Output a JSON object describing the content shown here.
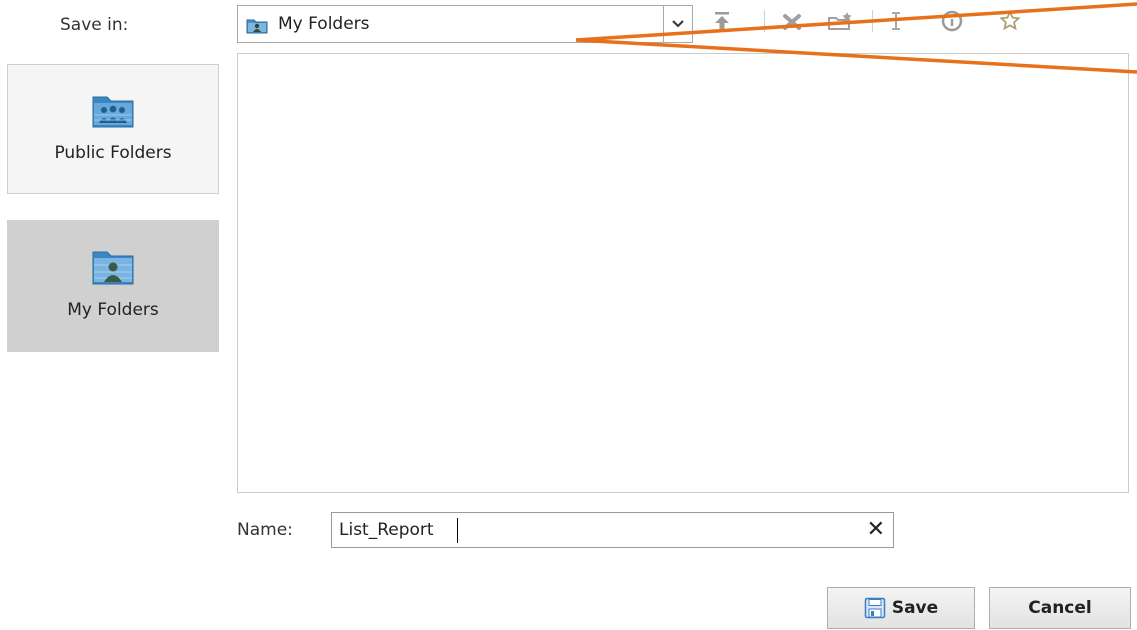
{
  "save_in": {
    "label": "Save in:",
    "current_folder": "My Folders"
  },
  "toolbar": {
    "icons": [
      "move-up-icon",
      "delete-icon",
      "new-folder-icon",
      "rename-icon",
      "properties-icon",
      "favorite-icon"
    ]
  },
  "places": [
    {
      "label": "Public Folders",
      "icon": "public-folders-icon",
      "selected": false
    },
    {
      "label": "My Folders",
      "icon": "my-folders-icon",
      "selected": true
    }
  ],
  "name": {
    "label": "Name:",
    "value": "List_Report"
  },
  "buttons": {
    "save": "Save",
    "cancel": "Cancel"
  },
  "colors": {
    "annotation": "#e8701a",
    "selected_place": "#d0d0d0",
    "folder_blue": "#3a87c4"
  }
}
